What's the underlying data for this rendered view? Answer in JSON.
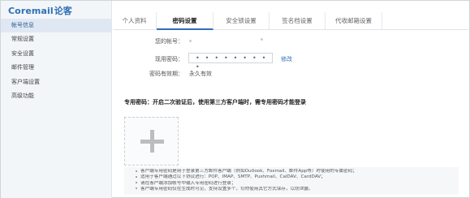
{
  "logo": {
    "brand": "Coremail",
    "brand_cn": "论客"
  },
  "sidebar": {
    "items": [
      {
        "label": "帐号信息",
        "active": true
      },
      {
        "label": "常规设置",
        "active": false
      },
      {
        "label": "安全设置",
        "active": false
      },
      {
        "label": "邮件管理",
        "active": false
      },
      {
        "label": "客户端设置",
        "active": false
      },
      {
        "label": "高级功能",
        "active": false
      }
    ]
  },
  "tabs": [
    {
      "label": "个人资料",
      "active": false
    },
    {
      "label": "密码设置",
      "active": true
    },
    {
      "label": "安全锁设置",
      "active": false
    },
    {
      "label": "签名档设置",
      "active": false
    },
    {
      "label": "代收邮箱设置",
      "active": false
    }
  ],
  "form": {
    "account_label": "您的帐号：",
    "password_label": "现用密码：",
    "password_value": "• • • • • • • • •",
    "modify_link": "修改",
    "validity_label": "密码有效期：",
    "validity_value": "永久有效"
  },
  "client_password": {
    "title": "专用密码：开启二次验证后，使用第三方客户端时，需专用密码才能登录",
    "add_icon": "plus-icon"
  },
  "notes": [
    "客户端专用密码是用于登录第三方邮件客户端（例如Outlook、Foxmail、邮件App等）时使用的专属密码；",
    "适用于客户端通过以下协议进行：POP、IMAP、SMTP、Pushmail、CalDAV、CardDAV；",
    "请在客户端添加帐号中输入专用密码进行登录；",
    "客户端专用密码仅在生成时可见，支持设置多个，切勿使用其它方式保存，以防泄露。"
  ]
}
